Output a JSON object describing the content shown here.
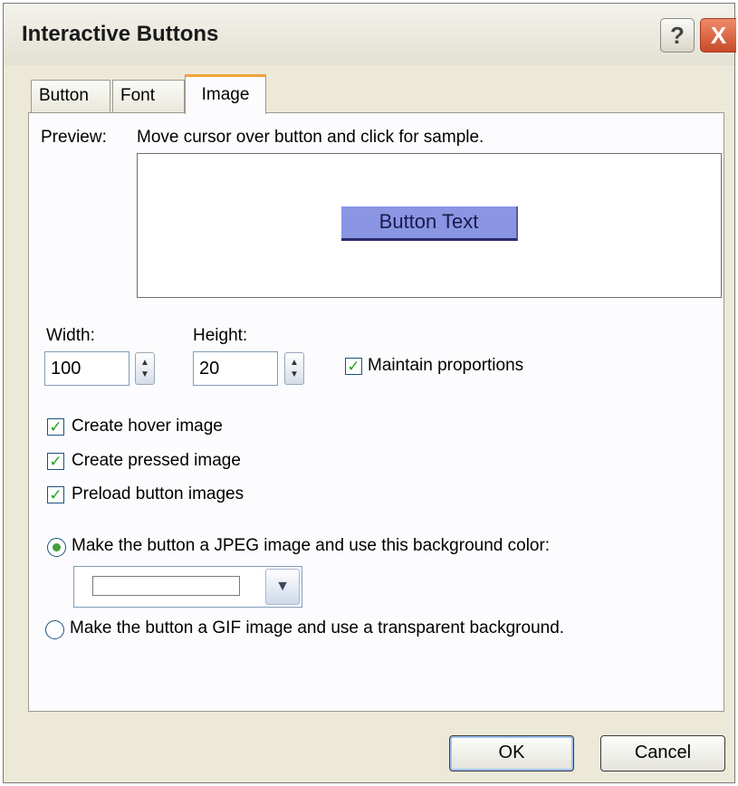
{
  "window": {
    "title": "Interactive Buttons",
    "help_glyph": "?",
    "close_glyph": "X"
  },
  "tabs": [
    {
      "label": "Button",
      "active": false
    },
    {
      "label": "Font",
      "active": false
    },
    {
      "label": "Image",
      "active": true
    }
  ],
  "preview": {
    "label": "Preview:",
    "hint": "Move cursor over button and click for sample.",
    "sample_button_text": "Button Text"
  },
  "size": {
    "width_label": "Width:",
    "width_value": "100",
    "height_label": "Height:",
    "height_value": "20",
    "maintain_label": "Maintain proportions",
    "maintain_checked": true
  },
  "options": [
    {
      "label": "Create hover image",
      "checked": true
    },
    {
      "label": "Create pressed image",
      "checked": true
    },
    {
      "label": "Preload button images",
      "checked": true
    }
  ],
  "format": {
    "jpeg_label": "Make the button a JPEG image and use this background color:",
    "jpeg_selected": true,
    "background_color": "#ffffff",
    "gif_label": "Make the button a GIF image and use a transparent background.",
    "gif_selected": false
  },
  "buttons": {
    "ok": "OK",
    "cancel": "Cancel"
  },
  "icons": {
    "check": "checkmark-icon",
    "spin": "spin-updown-icon",
    "dropdown": "chevron-down-icon"
  },
  "colors": {
    "dialog_bg": "#ece9d8",
    "active_tab_accent": "#f2a33a",
    "sample_button_bg": "#8a96e4",
    "check_green": "#21a121"
  }
}
